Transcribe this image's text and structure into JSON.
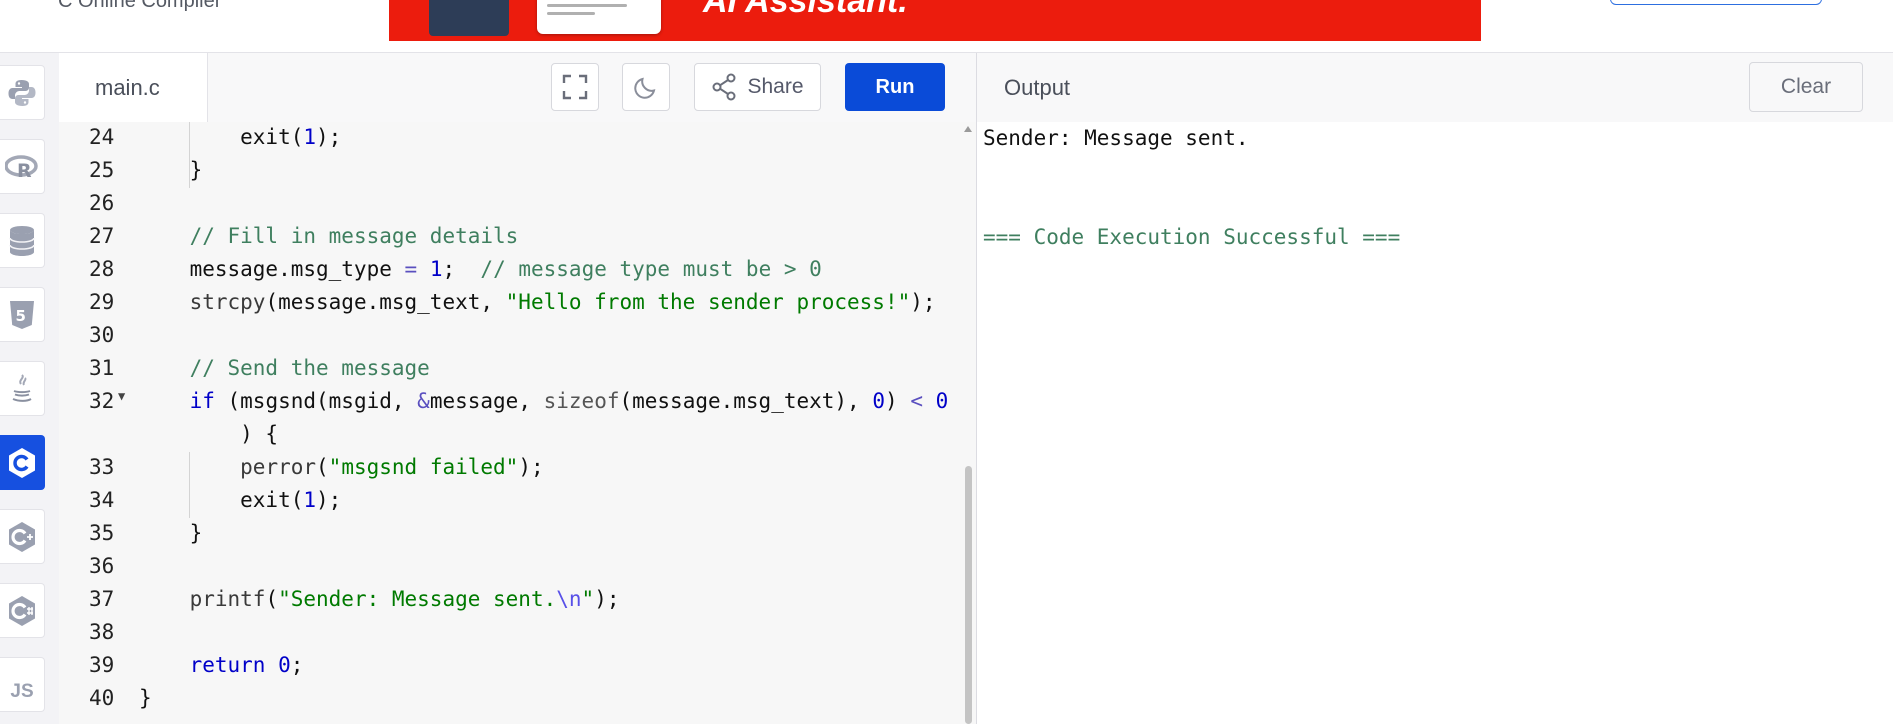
{
  "site": {
    "title": "C Online Compiler"
  },
  "ad": {
    "text": "AI Assistant."
  },
  "rail": {
    "items": [
      {
        "name": "python",
        "icon": "python-icon"
      },
      {
        "name": "r",
        "icon": "r-icon"
      },
      {
        "name": "sql",
        "icon": "database-icon"
      },
      {
        "name": "html",
        "icon": "html5-icon"
      },
      {
        "name": "java",
        "icon": "java-icon"
      },
      {
        "name": "c",
        "icon": "c-icon",
        "active": true
      },
      {
        "name": "cpp",
        "icon": "cpp-icon"
      },
      {
        "name": "csharp",
        "icon": "csharp-icon"
      },
      {
        "name": "javascript",
        "icon": "js-icon",
        "label": "JS"
      }
    ]
  },
  "editor": {
    "file_name": "main.c",
    "buttons": {
      "fullscreen_icon": "fullscreen-icon",
      "theme_icon": "moon-icon",
      "share_icon": "share-icon",
      "share_label": "Share",
      "run_label": "Run"
    },
    "lines": [
      {
        "num": "24",
        "text": "        exit(1);"
      },
      {
        "num": "25",
        "text": "    }"
      },
      {
        "num": "26",
        "text": ""
      },
      {
        "num": "27",
        "text": "    // Fill in message details"
      },
      {
        "num": "28",
        "text": "    message.msg_type = 1;  // message type must be > 0"
      },
      {
        "num": "29",
        "text": "    strcpy(message.msg_text, \"Hello from the sender process!\");"
      },
      {
        "num": "30",
        "text": ""
      },
      {
        "num": "31",
        "text": "    // Send the message"
      },
      {
        "num": "32",
        "text": "    if (msgsnd(msgid, &message, sizeof(message.msg_text), 0) < 0"
      },
      {
        "num": "",
        "text": "        ) {"
      },
      {
        "num": "33",
        "text": "        perror(\"msgsnd failed\");"
      },
      {
        "num": "34",
        "text": "        exit(1);"
      },
      {
        "num": "35",
        "text": "    }"
      },
      {
        "num": "36",
        "text": ""
      },
      {
        "num": "37",
        "text": "    printf(\"Sender: Message sent.\\n\");"
      },
      {
        "num": "38",
        "text": ""
      },
      {
        "num": "39",
        "text": "    return 0;"
      },
      {
        "num": "40",
        "text": "}"
      }
    ]
  },
  "output": {
    "title": "Output",
    "clear_label": "Clear",
    "lines": [
      "Sender: Message sent.",
      "",
      "",
      "=== Code Execution Successful ==="
    ]
  },
  "colors": {
    "run_button": "#0a4bd8",
    "active_rail": "#1650e0",
    "ad_banner": "#ec1c0d",
    "comment": "#3f7f5f",
    "keyword": "#0000c8",
    "string": "#007a00",
    "success_text": "#3f7f5f"
  }
}
